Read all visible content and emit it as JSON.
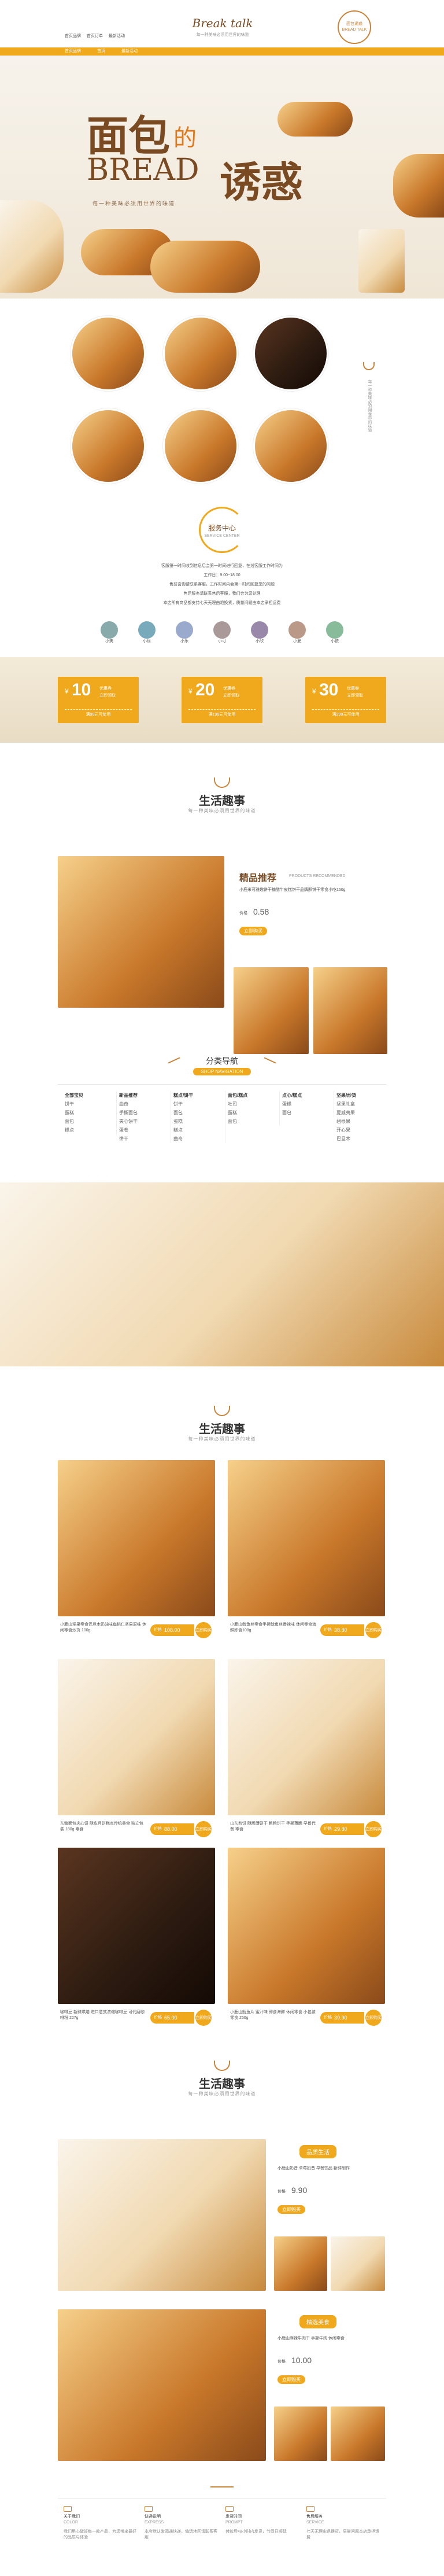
{
  "header": {
    "nav_left": [
      "首页品牌",
      "首页订单",
      "最新活动"
    ],
    "logo": "Break  talk",
    "slogan": "每一种美味必须用世界的味道",
    "seal": "面包诱惑 BREAD TALK",
    "menu": [
      "首页品牌",
      "首页",
      "最新活动"
    ]
  },
  "hero": {
    "title_cn": "面包",
    "title_de": "的",
    "title_en": "BREAD",
    "title_cn2": "诱惑",
    "subtitle": "每一种美味必须用世界的味道"
  },
  "side_note": "每一种美味必须用世界的味道",
  "service": {
    "title": "服务中心",
    "title_en": "SERVICE CENTER",
    "lines": [
      "客服第一时间收到信息后会第一时间进行回复，在线客服工作时间为",
      "工作日：9:00~18:00",
      "售前咨询请联系客服，工作时间内会第一时间回复您的问题",
      "售后服务请联系售后客服，我们会为您处理",
      "本店所有商品都支持七天无理由退换货，质量问题由本店承担运费"
    ],
    "agents": [
      "小美",
      "小优",
      "小乐",
      "小可",
      "小欣",
      "小夏",
      "小依"
    ]
  },
  "coupons": [
    {
      "amount": "10",
      "label": "优惠券",
      "cond": "满99元可使用",
      "get": "立即领取"
    },
    {
      "amount": "20",
      "label": "优惠券",
      "cond": "满199元可使用",
      "get": "立即领取"
    },
    {
      "amount": "30",
      "label": "优惠券",
      "cond": "满299元可使用",
      "get": "立即领取"
    }
  ],
  "life1": {
    "title": "生活趣事",
    "sub": "每一种美味必须用世界的味道"
  },
  "recommend": {
    "title": "精品推荐",
    "title_en": "PRODUCTS RECOMMENDED",
    "desc": "小鹿米可雅趣饼干糖醋牛皮糕饼干品牌酥饼干零食小吃150g",
    "price_label": "价格",
    "price": "0.58",
    "btn": "立即购买"
  },
  "catnav": {
    "title": "分类导航",
    "title_en": "SHOP NAVIGATION",
    "cols": [
      {
        "head": "全部宝贝",
        "items": [
          "饼干",
          "蛋糕",
          "面包",
          "糕点"
        ]
      },
      {
        "head": "新品推荐",
        "items": [
          "曲奇",
          "手撕面包",
          "夹心饼干",
          "蛋卷",
          "饼干"
        ]
      },
      {
        "head": "糕点/饼干",
        "items": [
          "饼干",
          "面包",
          "蛋糕",
          "糕点",
          "曲奇"
        ]
      },
      {
        "head": "面包/糕点",
        "items": [
          "吐司",
          "蛋糕",
          "面包"
        ]
      },
      {
        "head": "点心/糕点",
        "items": [
          "蛋糕",
          "面包"
        ]
      },
      {
        "head": "坚果/炒货",
        "items": [
          "坚果礼盒",
          "夏威夷果",
          "碧根果",
          "开心果",
          "巴旦木"
        ]
      }
    ]
  },
  "life2": {
    "title": "生活趣事",
    "sub": "每一种美味必须用世界的味道"
  },
  "products": [
    {
      "desc": "小鹿山坚果零食巴旦木奶油味扁桃仁坚果原味 休闲零食炒货 100g",
      "label": "价格",
      "price": "108.00",
      "buy": "立即购买"
    },
    {
      "desc": "小鹿山鱿鱼丝零食手撕鱿鱼丝香辣味 休闲零食海鲜即食108g",
      "label": "价格",
      "price": "38.80",
      "buy": "立即购买"
    },
    {
      "desc": "东糖面包夹心饼 酥皮月饼糕点传统美食 独立包装 180g 零食",
      "label": "价格",
      "price": "88.00",
      "buy": "立即购买"
    },
    {
      "desc": "山东煎饼 酥脆薄饼干 粗粮饼干 手撕薄脆 早餐代餐 零食",
      "label": "价格",
      "price": "29.80",
      "buy": "立即购买"
    },
    {
      "desc": "咖啡豆 新鲜烘焙 进口意式浓缩咖啡豆 可代磨咖啡粉 227g",
      "label": "价格",
      "price": "65.00",
      "buy": "立即购买"
    },
    {
      "desc": "小鹿山鱿鱼片 蜜汁味 即食海鲜 休闲零食 小包装零食 250g",
      "label": "价格",
      "price": "39.90",
      "buy": "立即购买"
    }
  ],
  "life3": {
    "title": "生活趣事",
    "sub": "每一种美味必须用世界的味道"
  },
  "feat1": {
    "tag": "品质生活",
    "desc": "小鹿山奶昔 草莓奶昔 早餐饮品 新鲜制作",
    "label": "价格",
    "price": "9.90",
    "btn": "立即购买"
  },
  "feat2": {
    "tag": "精选美食",
    "desc": "小鹿山麻辣牛肉干 手撕牛肉 休闲零食",
    "label": "价格",
    "price": "10.00",
    "btn": "立即购买"
  },
  "footer": {
    "cols": [
      {
        "head": "关于我们",
        "en": "COLOR",
        "text": "我们用心做好每一款产品，为您带来最好的品质与体验"
      },
      {
        "head": "快递说明",
        "en": "EXPRESS",
        "text": "本店默认发圆通快递，偏远地区请联系客服"
      },
      {
        "head": "发货时间",
        "en": "PROMPT",
        "text": "付款后48小时内发货，节假日顺延"
      },
      {
        "head": "售后服务",
        "en": "SERVICE",
        "text": "七天无理由退换货，质量问题本店承担运费"
      }
    ]
  },
  "colors": {
    "accent": "#f0a81c",
    "brown": "#7a4a22"
  }
}
